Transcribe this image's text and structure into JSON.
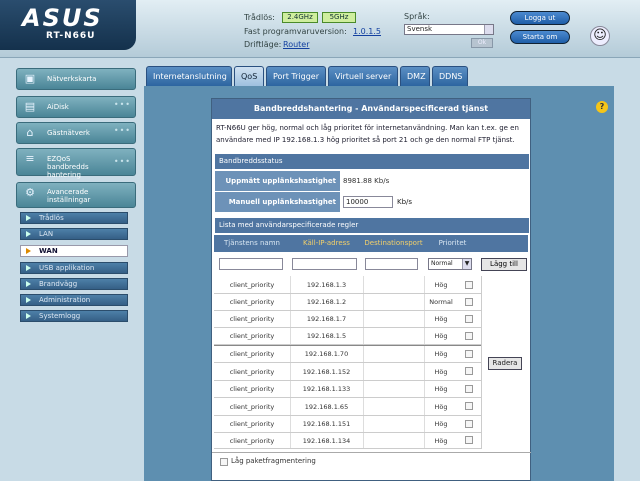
{
  "header": {
    "logo": "ASUS",
    "model": "RT-N66U",
    "wireless_label": "Trådlös:",
    "freq_24": "2.4GHz",
    "freq_5": "5GHz",
    "firmware_label": "Fast programvaruversion:",
    "firmware_value": "1.0.1.5",
    "mode_label": "Driftläge:",
    "mode_value": "Router",
    "language_label": "Språk:",
    "language_value": "Svensk",
    "apply_label": "Ok",
    "logout_label": "Logga ut",
    "reboot_label": "Starta om"
  },
  "sidebar": {
    "main_items": [
      {
        "label": "Nätverkskarta",
        "icon": "network-map-icon"
      },
      {
        "label": "AiDisk",
        "icon": "disk-icon"
      },
      {
        "label": "Gästnätverk",
        "icon": "guest-network-icon"
      },
      {
        "label": "EZQoS bandbredds hantering",
        "icon": "qos-icon"
      },
      {
        "label": "Avancerade inställningar",
        "icon": "settings-icon"
      }
    ],
    "sub_items": [
      "Trådlös",
      "LAN",
      "WAN",
      "USB applikation",
      "Brandvägg",
      "Administration",
      "Systemlogg"
    ],
    "selected_sub": "WAN"
  },
  "tabs": [
    "Internetanslutning",
    "QoS",
    "Port Trigger",
    "Virtuell server",
    "DMZ",
    "DDNS"
  ],
  "selected_tab": "QoS",
  "content": {
    "title": "Bandbreddshantering - Användarspecificerad tjänst",
    "description": "RT-N66U ger hög, normal och låg prioritet för internetanvändning. Man kan t.ex. ge en användare med IP 192.168.1.3 hög prioritet så port 21 och ge den normal FTP tjänst.",
    "bw_section": "Bandbreddsstatus",
    "bw_measured_label": "Uppmätt upplänkshastighet",
    "bw_measured_value": "8981.88 Kb/s",
    "bw_manual_label": "Manuell upplänkshastighet",
    "bw_manual_value": "10000",
    "bw_manual_unit": "Kb/s",
    "rules_section": "Lista med användarspecificerade regler",
    "col_service": "Tjänstens namn",
    "col_ip": "Käll-IP-adress",
    "col_port": "Destinationsport",
    "col_priority": "Prioritet",
    "priority_default": "Normal",
    "add_label": "Lägg till",
    "delete_label": "Radera",
    "footer_checkbox": "Låg paketfragmentering",
    "rules": [
      {
        "name": "client_priority",
        "ip": "192.168.1.3",
        "port": "",
        "priority": "Hög"
      },
      {
        "name": "client_priority",
        "ip": "192.168.1.2",
        "port": "",
        "priority": "Normal"
      },
      {
        "name": "client_priority",
        "ip": "192.168.1.7",
        "port": "",
        "priority": "Hög"
      },
      {
        "name": "client_priority",
        "ip": "192.168.1.5",
        "port": "",
        "priority": "Hög"
      },
      {
        "name": "client_priority",
        "ip": "192.168.1.70",
        "port": "",
        "priority": "Hög"
      },
      {
        "name": "client_priority",
        "ip": "192.168.1.152",
        "port": "",
        "priority": "Hög"
      },
      {
        "name": "client_priority",
        "ip": "192.168.1.133",
        "port": "",
        "priority": "Hög"
      },
      {
        "name": "client_priority",
        "ip": "192.168.1.65",
        "port": "",
        "priority": "Hög"
      },
      {
        "name": "client_priority",
        "ip": "192.168.1.151",
        "port": "",
        "priority": "Hög"
      },
      {
        "name": "client_priority",
        "ip": "192.168.1.134",
        "port": "",
        "priority": "Hög"
      }
    ]
  }
}
